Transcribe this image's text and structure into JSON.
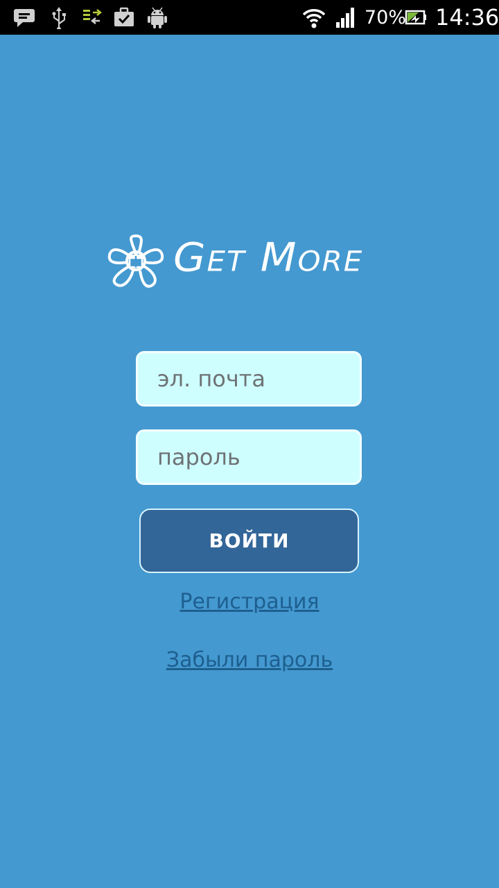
{
  "status_bar": {
    "icons": [
      "chat-notification-icon",
      "usb-icon",
      "data-transfer-icon",
      "briefcase-check-icon",
      "android-icon",
      "wifi-icon",
      "signal-icon",
      "battery-charging-icon"
    ],
    "battery_percent": "70%",
    "time": "14:36"
  },
  "logo": {
    "icon": "flower-gift-icon",
    "text": "Get More"
  },
  "login_form": {
    "email_placeholder": "эл. почта",
    "password_placeholder": "пароль",
    "submit_label": "ВОЙТИ",
    "register_link": "Регистрация",
    "forgot_password_link": "Забыли пароль"
  },
  "colors": {
    "background": "#4499d0",
    "field_background": "#cffeff",
    "button_background": "#336698",
    "link": "#1e5f8f"
  }
}
